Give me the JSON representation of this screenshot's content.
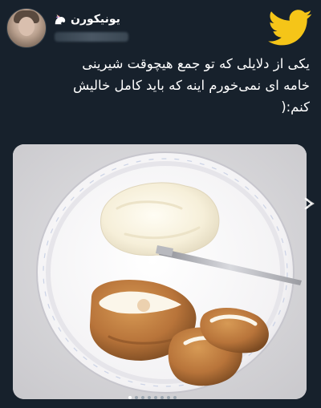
{
  "tweet": {
    "display_name": "یونیکورن",
    "name_icon": "unicorn-icon",
    "text": "یکی از دلایلی که تو جمع هیچوقت شیرینی\nخامه ای نمی‌خورم اینه که باید کامل خالیش\nکنم:(",
    "media": {
      "description_icon": "cream-puff-plate-photo",
      "carousel_count": 8,
      "carousel_active_index": 0
    }
  },
  "icons": {
    "brand": "twitter-bird-icon",
    "next": "carousel-next-icon",
    "avatar": "avatar-photo"
  },
  "colors": {
    "background": "#17212c",
    "twitter_yellow": "#f5c518",
    "text": "#ffffff"
  }
}
